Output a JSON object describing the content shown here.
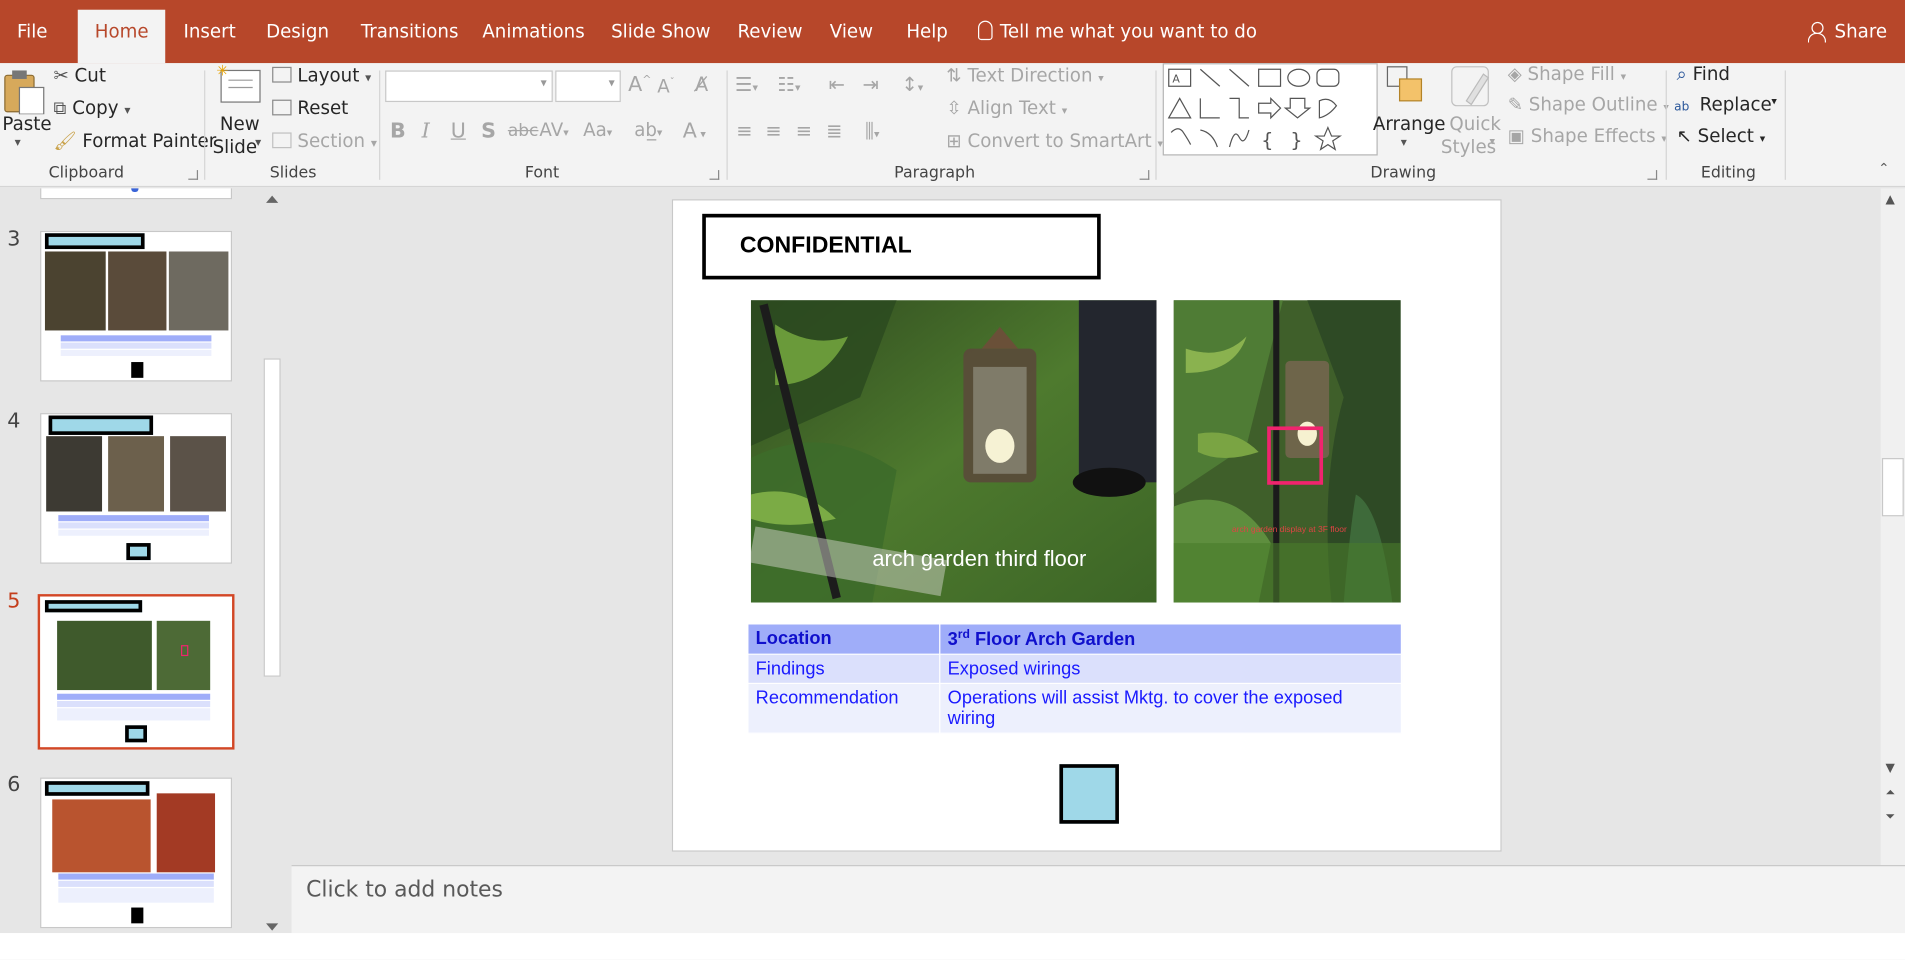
{
  "tabs": [
    "File",
    "Home",
    "Insert",
    "Design",
    "Transitions",
    "Animations",
    "Slide Show",
    "Review",
    "View",
    "Help"
  ],
  "active_tab": "Home",
  "tell_me": "Tell me what you want to do",
  "share": "Share",
  "clipboard": {
    "paste": "Paste",
    "cut": "Cut",
    "copy": "Copy",
    "format_painter": "Format Painter",
    "label": "Clipboard"
  },
  "slides_group": {
    "new_slide_1": "New",
    "new_slide_2": "Slide",
    "layout": "Layout",
    "reset": "Reset",
    "section": "Section",
    "label": "Slides"
  },
  "font_group": {
    "label": "Font",
    "font_name": "",
    "font_size": ""
  },
  "paragraph_group": {
    "label": "Paragraph",
    "text_direction": "Text Direction",
    "align_text": "Align Text",
    "convert_smartart": "Convert to SmartArt"
  },
  "drawing_group": {
    "label": "Drawing",
    "arrange": "Arrange",
    "quick_1": "Quick",
    "quick_2": "Styles",
    "shape_fill": "Shape Fill",
    "shape_outline": "Shape Outline",
    "shape_effects": "Shape Effects"
  },
  "editing_group": {
    "label": "Editing",
    "find": "Find",
    "replace": "Replace",
    "select": "Select"
  },
  "thumbnails": [
    {
      "number": "3",
      "selected": false
    },
    {
      "number": "4",
      "selected": false
    },
    {
      "number": "5",
      "selected": true
    },
    {
      "number": "6",
      "selected": false
    }
  ],
  "slide": {
    "confidential": "CONFIDENTIAL",
    "photo1_caption": "arch garden third floor",
    "photo2_caption": "arch garden display at 3F floor",
    "table": [
      {
        "label": "Location",
        "value_prefix": "3",
        "value_sup": "rd",
        "value": " Floor Arch Garden"
      },
      {
        "label": "Findings",
        "value": "Exposed wirings"
      },
      {
        "label": "Recommendation",
        "value": "Operations will assist Mktg. to cover the exposed wiring"
      }
    ]
  },
  "notes_placeholder": "Click to add notes",
  "colors": {
    "accent": "#b7472a",
    "selection": "#d24726",
    "table_header": "#9fadf9",
    "table_text": "#1a1aff",
    "highlight_frame": "#f0246e",
    "cyan": "#9fd8e8"
  }
}
